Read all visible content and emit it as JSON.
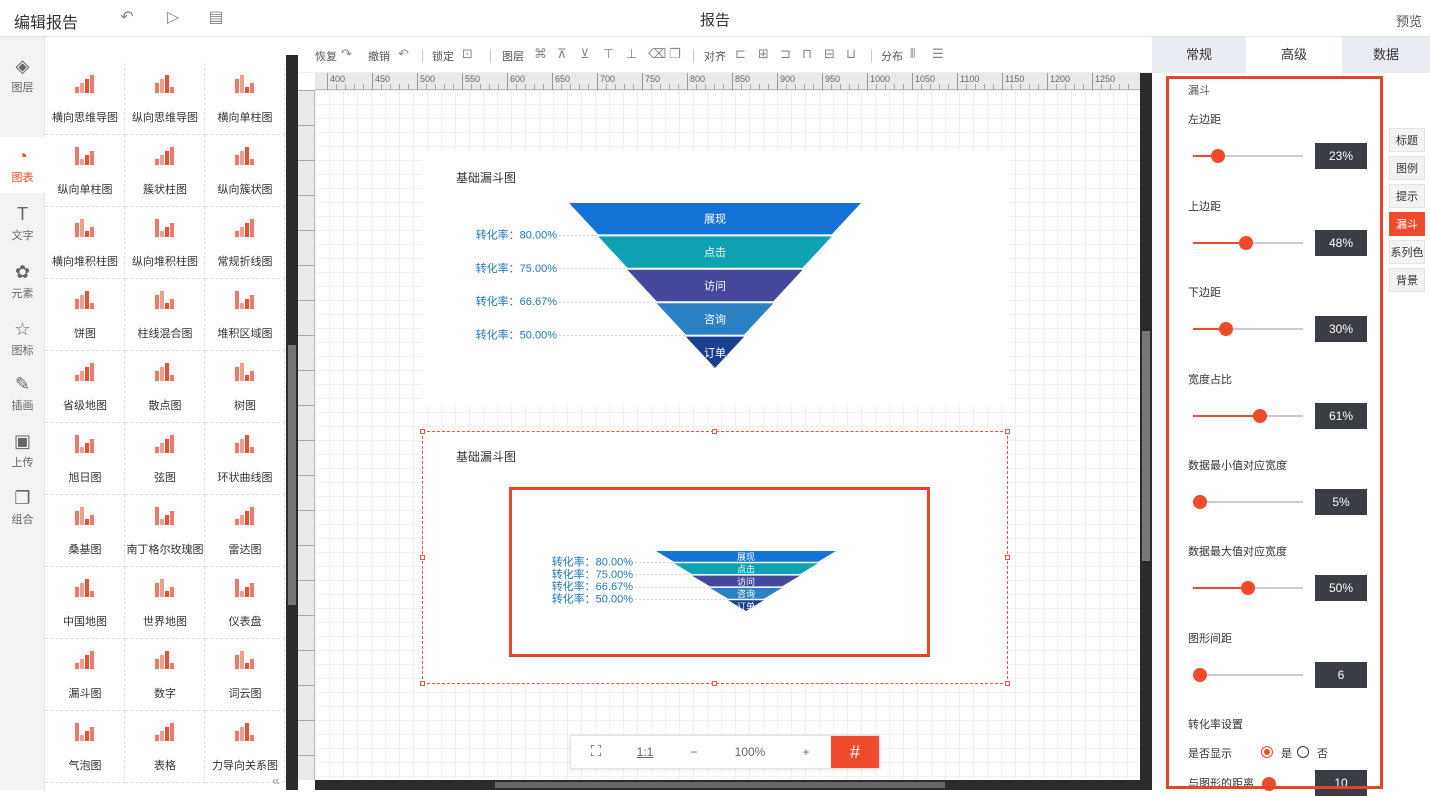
{
  "header": {
    "app_title": "编辑报告",
    "report_title": "报告",
    "preview": "预览"
  },
  "leftnav": [
    {
      "label": "图层",
      "icon": "layers-icon",
      "glyph": "◈"
    },
    {
      "label": "图表",
      "icon": "chart-icon",
      "glyph": "◔"
    },
    {
      "label": "文字",
      "icon": "text-icon",
      "glyph": "T"
    },
    {
      "label": "元素",
      "icon": "elements-icon",
      "glyph": "✿"
    },
    {
      "label": "图标",
      "icon": "star-icon",
      "glyph": "☆"
    },
    {
      "label": "插画",
      "icon": "illustration-icon",
      "glyph": "✎"
    },
    {
      "label": "上传",
      "icon": "upload-image-icon",
      "glyph": "▣"
    },
    {
      "label": "组合",
      "icon": "group-icon",
      "glyph": "❐"
    }
  ],
  "components": [
    "横向思维导图",
    "纵向思维导图",
    "横向单柱图",
    "纵向单柱图",
    "簇状柱图",
    "纵向簇状图",
    "横向堆积柱图",
    "纵向堆积柱图",
    "常规折线图",
    "饼图",
    "柱线混合图",
    "堆积区域图",
    "省级地图",
    "散点图",
    "树图",
    "旭日图",
    "弦图",
    "环状曲线图",
    "桑基图",
    "南丁格尔玫瑰图",
    "雷达图",
    "中国地图",
    "世界地图",
    "仪表盘",
    "漏斗图",
    "数字",
    "词云图",
    "气泡图",
    "表格",
    "力导向关系图"
  ],
  "toolbar": {
    "redo": "恢复",
    "undo": "撤销",
    "lock": "锁定",
    "layer": "图层",
    "align": "对齐",
    "distribute": "分布"
  },
  "ruler_labels": [
    "400",
    "450",
    "500",
    "550",
    "600",
    "650",
    "700",
    "750",
    "800",
    "850",
    "900",
    "950",
    "1000",
    "1050",
    "1100",
    "1150",
    "1200",
    "1250"
  ],
  "charts": [
    {
      "title": "基础漏斗图",
      "stages": [
        "展现",
        "点击",
        "访问",
        "咨询",
        "订单"
      ],
      "rates": [
        "转化率：80.00%",
        "转化率：75.00%",
        "转化率：66.67%",
        "转化率：50.00%"
      ],
      "colors": [
        "#1573d8",
        "#0fa2b3",
        "#45489b",
        "#2c80c4",
        "#1a3f8c"
      ]
    },
    {
      "title": "基础漏斗图",
      "stages": [
        "展现",
        "点击",
        "访问",
        "咨询",
        "订单"
      ],
      "rates": [
        "转化率：80.00%",
        "转化率：75.00%",
        "转化率：66.67%",
        "转化率：50.00%"
      ],
      "colors": [
        "#1573d8",
        "#0fa2b3",
        "#45489b",
        "#2c80c4",
        "#1a3f8c"
      ]
    }
  ],
  "zoombar": {
    "ratio": "1:1",
    "minus": "−",
    "zoom": "100%",
    "plus": "+"
  },
  "tabs": [
    {
      "label": "常规"
    },
    {
      "label": "高级"
    },
    {
      "label": "数据"
    }
  ],
  "panel": {
    "section": "漏斗",
    "params": [
      {
        "label": "左边距",
        "value": "23%",
        "level": 0.23
      },
      {
        "label": "上边距",
        "value": "48%",
        "level": 0.48
      },
      {
        "label": "下边距",
        "value": "30%",
        "level": 0.3
      },
      {
        "label": "宽度占比",
        "value": "61%",
        "level": 0.61
      },
      {
        "label": "数据最小值对应宽度",
        "value": "5%",
        "level": 0.05
      },
      {
        "label": "数据最大值对应宽度",
        "value": "50%",
        "level": 0.5
      },
      {
        "label": "图形间距",
        "value": "6",
        "level": 0.06
      }
    ],
    "conv_title": "转化率设置",
    "show_label": "是否显示",
    "yes": "是",
    "no": "否",
    "distance_label": "与图形的距离",
    "distance_value": "10"
  },
  "sidetabs": [
    {
      "label": "标题",
      "active": false
    },
    {
      "label": "图例",
      "active": false
    },
    {
      "label": "提示",
      "active": false
    },
    {
      "label": "漏斗",
      "active": true
    },
    {
      "label": "系列色",
      "active": false
    },
    {
      "label": "背景",
      "active": false
    }
  ],
  "colors": {
    "accent": "#f04a2c",
    "dark": "#3a3d44"
  }
}
